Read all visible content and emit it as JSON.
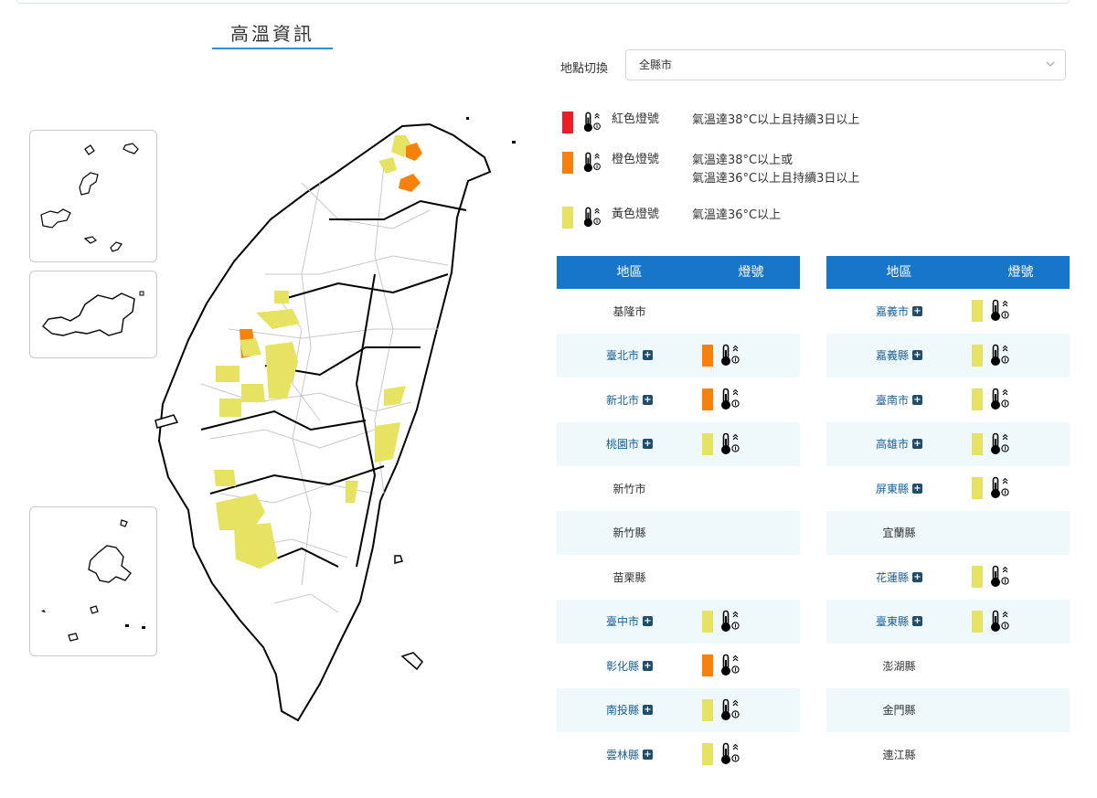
{
  "page": {
    "title": "高溫資訊"
  },
  "location": {
    "label": "地點切換",
    "selected": "全縣市"
  },
  "colors": {
    "red": "#ee1c25",
    "orange": "#f7810a",
    "yellow": "#e6e262",
    "header_blue": "#1876c8"
  },
  "legend": [
    {
      "name": "紅色燈號",
      "color": "red",
      "desc": [
        "氣溫達38°C以上且持續3日以上"
      ]
    },
    {
      "name": "橙色燈號",
      "color": "orange",
      "desc": [
        "氣溫達38°C以上或",
        "氣溫達36°C以上且持續3日以上"
      ]
    },
    {
      "name": "黃色燈號",
      "color": "yellow",
      "desc": [
        "氣溫達36°C以上"
      ]
    }
  ],
  "table": {
    "header_area": "地區",
    "header_light": "燈號",
    "left": [
      {
        "area": "基隆市",
        "expandable": false,
        "light": null
      },
      {
        "area": "臺北市",
        "expandable": true,
        "light": "orange"
      },
      {
        "area": "新北市",
        "expandable": true,
        "light": "orange"
      },
      {
        "area": "桃園市",
        "expandable": true,
        "light": "yellow"
      },
      {
        "area": "新竹市",
        "expandable": false,
        "light": null
      },
      {
        "area": "新竹縣",
        "expandable": false,
        "light": null
      },
      {
        "area": "苗栗縣",
        "expandable": false,
        "light": null
      },
      {
        "area": "臺中市",
        "expandable": true,
        "light": "yellow"
      },
      {
        "area": "彰化縣",
        "expandable": true,
        "light": "orange"
      },
      {
        "area": "南投縣",
        "expandable": true,
        "light": "yellow"
      },
      {
        "area": "雲林縣",
        "expandable": true,
        "light": "yellow"
      }
    ],
    "right": [
      {
        "area": "嘉義市",
        "expandable": true,
        "light": "yellow"
      },
      {
        "area": "嘉義縣",
        "expandable": true,
        "light": "yellow"
      },
      {
        "area": "臺南市",
        "expandable": true,
        "light": "yellow"
      },
      {
        "area": "高雄市",
        "expandable": true,
        "light": "yellow"
      },
      {
        "area": "屏東縣",
        "expandable": true,
        "light": "yellow"
      },
      {
        "area": "宜蘭縣",
        "expandable": false,
        "light": null
      },
      {
        "area": "花蓮縣",
        "expandable": true,
        "light": "yellow"
      },
      {
        "area": "臺東縣",
        "expandable": true,
        "light": "yellow"
      },
      {
        "area": "澎湖縣",
        "expandable": false,
        "light": null
      },
      {
        "area": "金門縣",
        "expandable": false,
        "light": null
      },
      {
        "area": "連江縣",
        "expandable": false,
        "light": null
      }
    ]
  },
  "icons": {
    "thermometer": "thermometer-warning-icon",
    "plus": "plus-square-icon",
    "dropdown": "chevron-down-icon"
  }
}
